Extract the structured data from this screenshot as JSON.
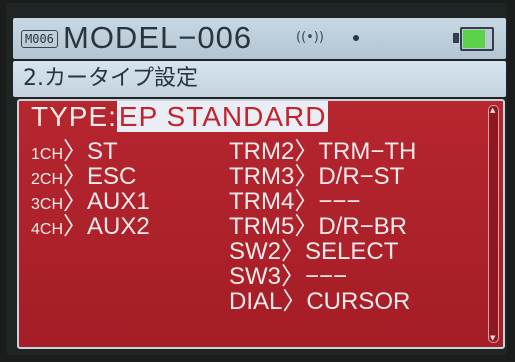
{
  "header": {
    "model_badge": "M006",
    "model_name": "MODEL−006",
    "antenna_icon": "antenna-icon",
    "status_dot_icon": "dot-icon",
    "battery_level_percent": 80,
    "battery_color": "#5bd24a"
  },
  "subtitle": {
    "text": "2.カータイプ設定"
  },
  "panel": {
    "type_label": "TYPE:",
    "type_value": "EP STANDARD",
    "channels": [
      {
        "prefix": "1CH",
        "suffix": "〉ST"
      },
      {
        "prefix": "2CH",
        "suffix": "〉ESC"
      },
      {
        "prefix": "3CH",
        "suffix": "〉AUX1"
      },
      {
        "prefix": "4CH",
        "suffix": "〉AUX2"
      }
    ],
    "assignments": [
      "TRM2〉TRM−TH",
      "TRM3〉D/R−ST",
      "TRM4〉−−−",
      "TRM5〉D/R−BR",
      "SW2〉SELECT",
      "SW3〉−−−",
      "DIAL〉CURSOR"
    ]
  },
  "colors": {
    "panel_red": "#b6262f",
    "header_blue": "#c8d7e3",
    "highlight": "#eaeef4"
  }
}
